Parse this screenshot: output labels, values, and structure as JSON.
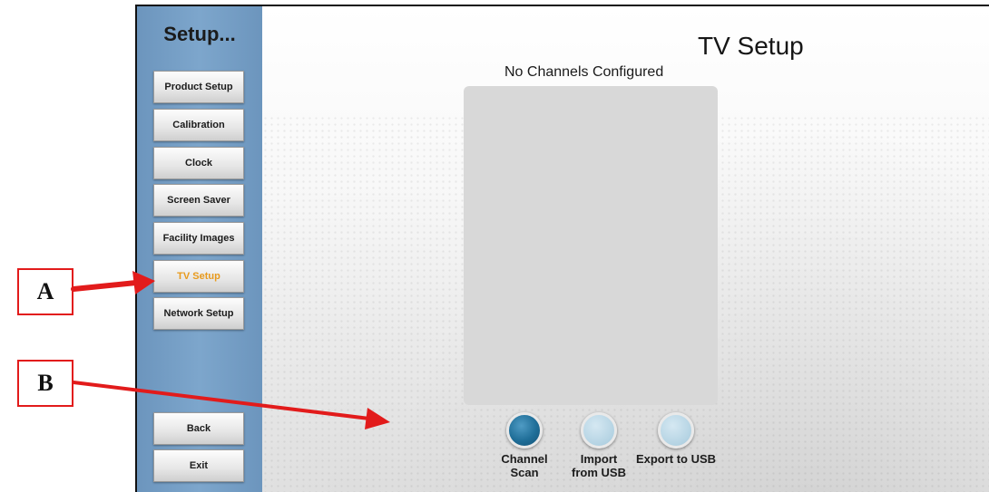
{
  "sidebar": {
    "title": "Setup...",
    "items": [
      {
        "label": "Product Setup",
        "active": false
      },
      {
        "label": "Calibration",
        "active": false
      },
      {
        "label": "Clock",
        "active": false
      },
      {
        "label": "Screen Saver",
        "active": false
      },
      {
        "label": "Facility Images",
        "active": false
      },
      {
        "label": "TV Setup",
        "active": true
      },
      {
        "label": "Network Setup",
        "active": false
      }
    ],
    "back_label": "Back",
    "exit_label": "Exit"
  },
  "main": {
    "title": "TV Setup",
    "channels_status": "No Channels Configured",
    "actions": [
      {
        "label": "Channel\nScan",
        "state": "active"
      },
      {
        "label": "Import\nfrom USB",
        "state": "inactive"
      },
      {
        "label": "Export to USB",
        "state": "inactive"
      }
    ]
  },
  "callouts": [
    {
      "label": "A",
      "points_to": "TV Setup"
    },
    {
      "label": "B",
      "points_to": "Channel Scan"
    }
  ],
  "colors": {
    "active_menu_text": "#e89a1c",
    "sidebar": "#7da6cc",
    "callout_red": "#e21b1b",
    "active_button": "#1f6e98",
    "inactive_button": "#b4d3e3"
  }
}
